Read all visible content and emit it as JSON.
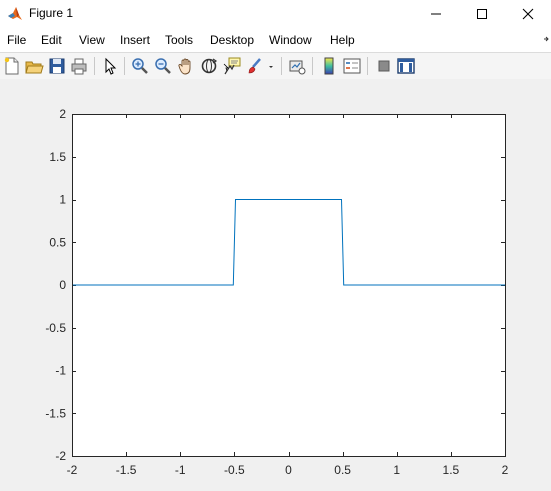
{
  "window": {
    "title": "Figure 1"
  },
  "menu": {
    "items": [
      "File",
      "Edit",
      "View",
      "Insert",
      "Tools",
      "Desktop",
      "Window",
      "Help"
    ]
  },
  "toolbar": {
    "buttons": [
      "new-figure-icon",
      "open-file-icon",
      "save-icon",
      "print-icon",
      "edit-plot-arrow-icon",
      "zoom-in-icon",
      "zoom-out-icon",
      "pan-hand-icon",
      "rotate-3d-icon",
      "data-cursor-icon",
      "brush-icon",
      "link-plot-icon",
      "colorbar-icon",
      "legend-icon",
      "hide-plot-tools-icon",
      "show-plot-tools-icon"
    ]
  },
  "colors": {
    "line": "#0072bd",
    "axes_bg": "#ffffff",
    "figure_bg": "#f0f0f0"
  },
  "chart_data": {
    "type": "line",
    "title": "",
    "xlabel": "",
    "ylabel": "",
    "xlim": [
      -2,
      2
    ],
    "ylim": [
      -2,
      2
    ],
    "x_ticks": [
      "-2",
      "-1.5",
      "-1",
      "-0.5",
      "0",
      "0.5",
      "1",
      "1.5",
      "2"
    ],
    "y_ticks": [
      "2",
      "1.5",
      "1",
      "0.5",
      "0",
      "-0.5",
      "-1",
      "-1.5",
      "-2"
    ],
    "grid": false,
    "series": [
      {
        "x": [
          -2,
          -0.51,
          -0.49,
          0.49,
          0.51,
          2
        ],
        "y": [
          0,
          0,
          1,
          1,
          0,
          0
        ]
      }
    ]
  }
}
